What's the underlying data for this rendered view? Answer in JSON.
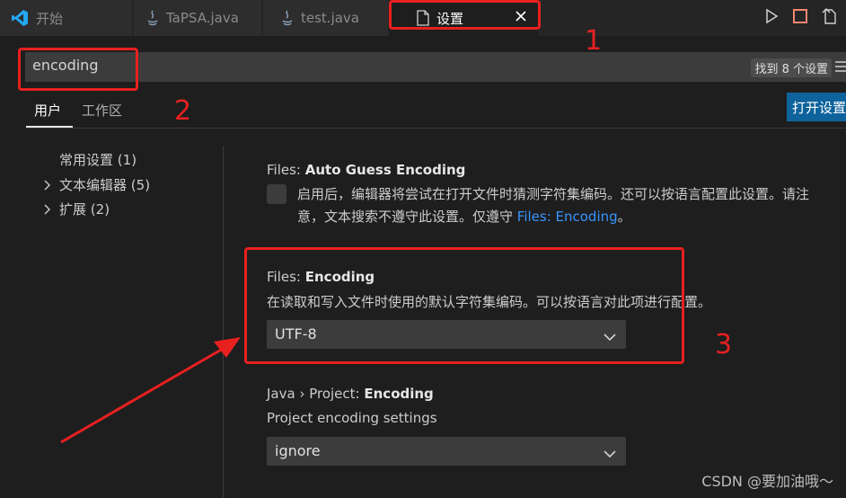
{
  "tabs": [
    {
      "label": "开始",
      "icon": "vscode-logo-icon"
    },
    {
      "label": "TaPSA.java",
      "icon": "java-icon"
    },
    {
      "label": "test.java",
      "icon": "java-icon"
    },
    {
      "label": "设置",
      "icon": "file-icon"
    }
  ],
  "search": {
    "value": "encoding",
    "found": "找到 8 个设置"
  },
  "scopes": {
    "user": "用户",
    "workspace": "工作区"
  },
  "open_settings_label": "打开设置",
  "toc": [
    {
      "label": "常用设置",
      "count": "(1)",
      "expandable": false
    },
    {
      "label": "文本编辑器",
      "count": "(5)",
      "expandable": true
    },
    {
      "label": "扩展",
      "count": "(2)",
      "expandable": true
    }
  ],
  "settings": {
    "auto_guess": {
      "category": "Files: ",
      "name": "Auto Guess Encoding",
      "desc_line1": "启用后，编辑器将尝试在打开文件时猜测字符集编码。还可以按语言配置此设置。请注",
      "desc_line2_prefix": "意，文本搜索不遵守此设置。仅遵守 ",
      "desc_link": "Files: Encoding",
      "desc_line2_suffix": "。"
    },
    "encoding": {
      "category": "Files: ",
      "name": "Encoding",
      "desc": "在读取和写入文件时使用的默认字符集编码。可以按语言对此项进行配置。",
      "value": "UTF-8"
    },
    "java_encoding": {
      "category": "Java › Project: ",
      "name": "Encoding",
      "desc": "Project encoding settings",
      "value": "ignore"
    }
  },
  "annotations": {
    "n1": "1",
    "n2": "2",
    "n3": "3"
  },
  "watermark": "CSDN @要加油哦～",
  "colors": {
    "accent": "#0e639c",
    "annotation": "#e82020",
    "link": "#3794ff"
  }
}
